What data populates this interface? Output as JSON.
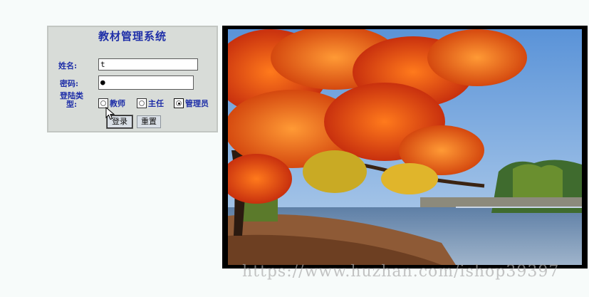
{
  "login": {
    "title": "教材管理系统",
    "name_label": "姓名:",
    "name_value": "t",
    "password_label": "密码:",
    "password_value": "●",
    "type_label_line1": "登陆类",
    "type_label_line2": "型:",
    "radios": [
      {
        "label": "教师",
        "checked": false
      },
      {
        "label": "主任",
        "checked": false
      },
      {
        "label": "管理员",
        "checked": true
      }
    ],
    "login_button": "登录",
    "reset_button": "重置"
  },
  "watermark": "https://www.huzhan.com/ishop39397",
  "colors": {
    "label_blue": "#1f2fa8",
    "panel_bg": "#d8dcd8"
  }
}
